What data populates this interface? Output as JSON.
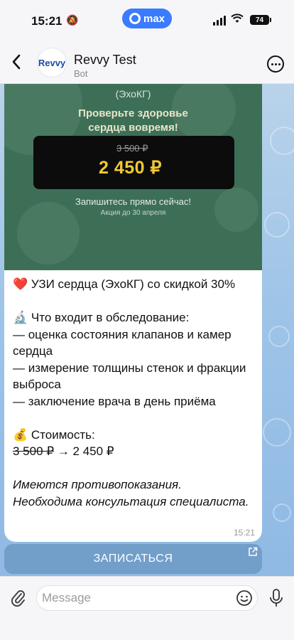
{
  "status_bar": {
    "time": "15:21",
    "app_pill": "max",
    "battery": "74"
  },
  "header": {
    "avatar_text": "Revvy",
    "title": "Revvy Test",
    "subtitle": "Bot"
  },
  "promo": {
    "subtitle": "(ЭхоКГ)",
    "headline_line1": "Проверьте здоровье",
    "headline_line2": "сердца вовремя!",
    "old_price": "3 500 ₽",
    "new_price": "2 450 ₽",
    "cta": "Запишитесь прямо сейчас!",
    "deadline": "Акция до 30 апреля"
  },
  "message": {
    "title": "❤️ УЗИ сердца (ЭхоКГ) со скидкой 30%",
    "includes_heading": "🔬 Что входит в обследование:",
    "includes_items": [
      "— оценка состояния клапанов и камер сердца",
      "— измерение толщины стенок и фракции выброса",
      "— заключение врача в день приёма"
    ],
    "cost_heading": "💰 Стоимость:",
    "cost_old": "3 500 ₽",
    "cost_arrow": " → ",
    "cost_new": "2 450 ₽",
    "disclaimer_line1": "Имеются противопоказания.",
    "disclaimer_line2": "Необходима консультация специалиста.",
    "time": "15:21"
  },
  "inline_button": {
    "label": "ЗАПИСАТЬСЯ"
  },
  "input": {
    "placeholder": "Message"
  },
  "colors": {
    "promo_bg": "#3d6f57",
    "price_accent": "#f2c932",
    "brand_blue": "#3a7bff"
  }
}
